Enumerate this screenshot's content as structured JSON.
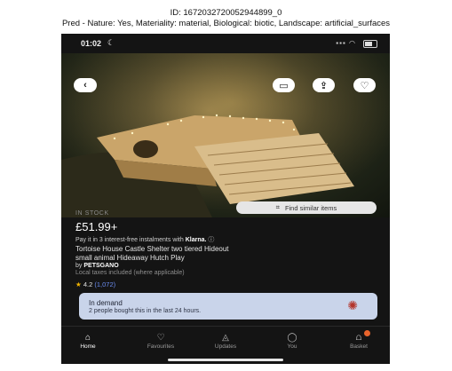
{
  "caption": {
    "id_line": "ID: 1672032720052944899_0",
    "pred_line": "Pred - Nature: Yes, Materiality: material, Biological: biotic, Landscape: artificial_surfaces"
  },
  "status": {
    "time": "01:02"
  },
  "product": {
    "stock": "IN STOCK",
    "price": "£51.99+",
    "klarna_prefix": "Pay it in 3 interest-free instalments with",
    "klarna_brand": "Klarna.",
    "title_line1": "Tortoise House Castle Shelter two tiered Hideout",
    "title_line2": "small animal Hideaway Hutch Play",
    "seller_prefix": "by",
    "seller": "PETSGANO",
    "taxes": "Local taxes included (where applicable)",
    "rating": "4.2",
    "rating_count": "(1,072)",
    "find_similar": "Find similar items"
  },
  "demand": {
    "title": "In demand",
    "subtitle": "2 people bought this in the last 24 hours."
  },
  "tabs": [
    {
      "label": "Home",
      "icon": "home-icon"
    },
    {
      "label": "Favourites",
      "icon": "heart-icon"
    },
    {
      "label": "Updates",
      "icon": "bell-icon"
    },
    {
      "label": "You",
      "icon": "person-icon"
    },
    {
      "label": "Basket",
      "icon": "basket-icon"
    }
  ],
  "colors": {
    "background": "#141414",
    "demand_card": "#c9d4ea",
    "rating_star": "#f1b400",
    "badge": "#e8642c"
  }
}
